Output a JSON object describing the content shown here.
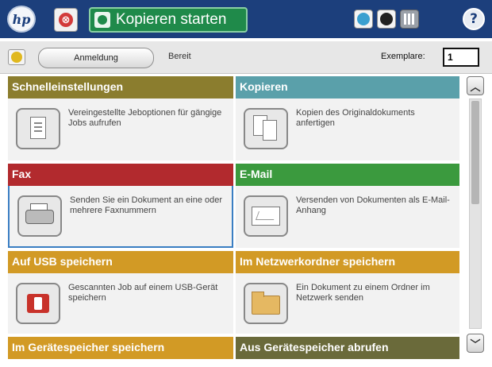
{
  "topbar": {
    "logo": "hp",
    "start_label": "Kopieren starten",
    "help_glyph": "?",
    "stop_glyph": "⊗"
  },
  "subbar": {
    "login_label": "Anmeldung",
    "status": "Bereit",
    "copies_label": "Exemplare:",
    "copies_value": "1"
  },
  "tiles": [
    {
      "title": "Schnelleinstellungen",
      "desc": "Vereingestellte Jeboptionen für gängige Jobs aufrufen",
      "color": "#8b7d2e",
      "icon": "quick-sets-icon"
    },
    {
      "title": "Kopieren",
      "desc": "Kopien des Originaldokuments anfertigen",
      "color": "#5aa0aa",
      "icon": "copy-icon"
    },
    {
      "title": "Fax",
      "desc": "Senden Sie ein Dokument an eine oder mehrere Faxnummern",
      "color": "#b22a2e",
      "icon": "fax-icon"
    },
    {
      "title": "E-Mail",
      "desc": "Versenden von Dokumenten als E-Mail-Anhang",
      "color": "#3b9a3e",
      "icon": "email-icon"
    },
    {
      "title": "Auf USB speichern",
      "desc": "Gescannten Job auf einem USB-Gerät speichern",
      "color": "#d29a25",
      "icon": "usb-icon"
    },
    {
      "title": "Im Netzwerkordner speichern",
      "desc": "Ein Dokument zu einem Ordner im Netzwerk senden",
      "color": "#d29a25",
      "icon": "network-folder-icon"
    },
    {
      "title": "Im Gerätespeicher speichern",
      "color": "#d29a25"
    },
    {
      "title": "Aus Gerätespeicher abrufen",
      "color": "#6a6a3a"
    }
  ],
  "scroll": {
    "up_glyph": "︿",
    "down_glyph": "﹀"
  }
}
